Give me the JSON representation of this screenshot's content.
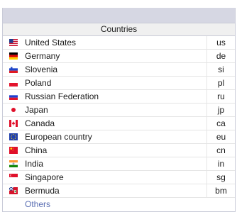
{
  "header": {
    "title": "Countries"
  },
  "rows": [
    {
      "name": "United States",
      "code": "us",
      "flag": "us-flag-icon"
    },
    {
      "name": "Germany",
      "code": "de",
      "flag": "de-flag-icon"
    },
    {
      "name": "Slovenia",
      "code": "si",
      "flag": "si-flag-icon"
    },
    {
      "name": "Poland",
      "code": "pl",
      "flag": "pl-flag-icon"
    },
    {
      "name": "Russian Federation",
      "code": "ru",
      "flag": "ru-flag-icon"
    },
    {
      "name": "Japan",
      "code": "jp",
      "flag": "jp-flag-icon"
    },
    {
      "name": "Canada",
      "code": "ca",
      "flag": "ca-flag-icon"
    },
    {
      "name": "European country",
      "code": "eu",
      "flag": "eu-flag-icon"
    },
    {
      "name": "China",
      "code": "cn",
      "flag": "cn-flag-icon"
    },
    {
      "name": "India",
      "code": "in",
      "flag": "in-flag-icon"
    },
    {
      "name": "Singapore",
      "code": "sg",
      "flag": "sg-flag-icon"
    },
    {
      "name": "Bermuda",
      "code": "bm",
      "flag": "bm-flag-icon"
    }
  ],
  "others_label": "Others",
  "colors": {
    "title_bar": "#d6d7e3",
    "others_link": "#5b6fb3"
  }
}
